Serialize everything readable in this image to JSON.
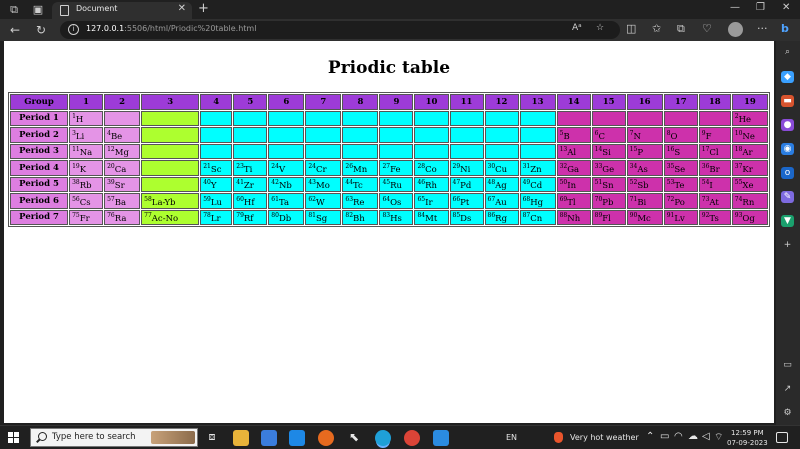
{
  "browser": {
    "tab_title": "Document",
    "url_host": "127.0.0.1",
    "url_rest": ":5506/html/Priodic%20table.html"
  },
  "page": {
    "title": "Priodic table"
  },
  "table": {
    "headers": [
      "Group",
      "1",
      "2",
      "3",
      "4",
      "5",
      "6",
      "7",
      "8",
      "9",
      "10",
      "11",
      "12",
      "13",
      "14",
      "15",
      "16",
      "17",
      "18",
      "19"
    ],
    "rows": [
      {
        "label": "Period 1",
        "cells": [
          [
            "pink",
            "1",
            "H"
          ],
          [
            "pink",
            "",
            ""
          ],
          [
            "lime",
            "",
            ""
          ],
          [
            "cyan",
            "",
            ""
          ],
          [
            "cyan",
            "",
            ""
          ],
          [
            "cyan",
            "",
            ""
          ],
          [
            "cyan",
            "",
            ""
          ],
          [
            "cyan",
            "",
            ""
          ],
          [
            "cyan",
            "",
            ""
          ],
          [
            "cyan",
            "",
            ""
          ],
          [
            "cyan",
            "",
            ""
          ],
          [
            "cyan",
            "",
            ""
          ],
          [
            "cyan",
            "",
            ""
          ],
          [
            "mag",
            "",
            ""
          ],
          [
            "mag",
            "",
            ""
          ],
          [
            "mag",
            "",
            ""
          ],
          [
            "mag",
            "",
            ""
          ],
          [
            "mag",
            "",
            ""
          ],
          [
            "mag",
            "2",
            "He"
          ]
        ]
      },
      {
        "label": "Period 2",
        "cells": [
          [
            "pink",
            "3",
            "Li"
          ],
          [
            "pink",
            "4",
            "Be"
          ],
          [
            "lime",
            "",
            ""
          ],
          [
            "cyan",
            "",
            ""
          ],
          [
            "cyan",
            "",
            ""
          ],
          [
            "cyan",
            "",
            ""
          ],
          [
            "cyan",
            "",
            ""
          ],
          [
            "cyan",
            "",
            ""
          ],
          [
            "cyan",
            "",
            ""
          ],
          [
            "cyan",
            "",
            ""
          ],
          [
            "cyan",
            "",
            ""
          ],
          [
            "cyan",
            "",
            ""
          ],
          [
            "cyan",
            "",
            ""
          ],
          [
            "mag",
            "5",
            "B"
          ],
          [
            "mag",
            "6",
            "C"
          ],
          [
            "mag",
            "7",
            "N"
          ],
          [
            "mag",
            "8",
            "O"
          ],
          [
            "mag",
            "9",
            "F"
          ],
          [
            "mag",
            "10",
            "Ne"
          ]
        ]
      },
      {
        "label": "Period 3",
        "cells": [
          [
            "pink",
            "11",
            "Na"
          ],
          [
            "pink",
            "12",
            "Mg"
          ],
          [
            "lime",
            "",
            ""
          ],
          [
            "cyan",
            "",
            ""
          ],
          [
            "cyan",
            "",
            ""
          ],
          [
            "cyan",
            "",
            ""
          ],
          [
            "cyan",
            "",
            ""
          ],
          [
            "cyan",
            "",
            ""
          ],
          [
            "cyan",
            "",
            ""
          ],
          [
            "cyan",
            "",
            ""
          ],
          [
            "cyan",
            "",
            ""
          ],
          [
            "cyan",
            "",
            ""
          ],
          [
            "cyan",
            "",
            ""
          ],
          [
            "mag",
            "13",
            "Al"
          ],
          [
            "mag",
            "14",
            "Si"
          ],
          [
            "mag",
            "15",
            "P"
          ],
          [
            "mag",
            "16",
            "S"
          ],
          [
            "mag",
            "17",
            "Cl"
          ],
          [
            "mag",
            "18",
            "Ar"
          ]
        ]
      },
      {
        "label": "Period 4",
        "cells": [
          [
            "pink",
            "19",
            "K"
          ],
          [
            "pink",
            "20",
            "Ca"
          ],
          [
            "lime",
            "",
            ""
          ],
          [
            "cyan",
            "21",
            "Sc"
          ],
          [
            "cyan",
            "23",
            "Ti"
          ],
          [
            "cyan",
            "24",
            "V"
          ],
          [
            "cyan",
            "24",
            "Cr"
          ],
          [
            "cyan",
            "26",
            "Mn"
          ],
          [
            "cyan",
            "27",
            "Fe"
          ],
          [
            "cyan",
            "28",
            "Co"
          ],
          [
            "cyan",
            "29",
            "Ni"
          ],
          [
            "cyan",
            "30",
            "Cu"
          ],
          [
            "cyan",
            "31",
            "Zn"
          ],
          [
            "mag",
            "32",
            "Ga"
          ],
          [
            "mag",
            "33",
            "Ge"
          ],
          [
            "mag",
            "34",
            "As"
          ],
          [
            "mag",
            "35",
            "Se"
          ],
          [
            "mag",
            "36",
            "Br"
          ],
          [
            "mag",
            "37",
            "Kr"
          ]
        ]
      },
      {
        "label": "Period 5",
        "cells": [
          [
            "pink",
            "38",
            "Rb"
          ],
          [
            "pink",
            "39",
            "Sr"
          ],
          [
            "lime",
            "",
            ""
          ],
          [
            "cyan",
            "40",
            "Y"
          ],
          [
            "cyan",
            "41",
            "Zr"
          ],
          [
            "cyan",
            "42",
            "Nb"
          ],
          [
            "cyan",
            "43",
            "Mo"
          ],
          [
            "cyan",
            "44",
            "Tc"
          ],
          [
            "cyan",
            "45",
            "Ru"
          ],
          [
            "cyan",
            "46",
            "Rh"
          ],
          [
            "cyan",
            "47",
            "Pd"
          ],
          [
            "cyan",
            "48",
            "Ag"
          ],
          [
            "cyan",
            "49",
            "Cd"
          ],
          [
            "mag",
            "50",
            "In"
          ],
          [
            "mag",
            "51",
            "Sn"
          ],
          [
            "mag",
            "52",
            "Sb"
          ],
          [
            "mag",
            "53",
            "Te"
          ],
          [
            "mag",
            "54",
            "I"
          ],
          [
            "mag",
            "55",
            "Xe"
          ]
        ]
      },
      {
        "label": "Period 6",
        "cells": [
          [
            "pink",
            "56",
            "Cs"
          ],
          [
            "pink",
            "57",
            "Ba"
          ],
          [
            "lime",
            "58",
            "La-Yb"
          ],
          [
            "cyan",
            "59",
            "Lu"
          ],
          [
            "cyan",
            "60",
            "Hf"
          ],
          [
            "cyan",
            "61",
            "Ta"
          ],
          [
            "cyan",
            "62",
            "W"
          ],
          [
            "cyan",
            "63",
            "Re"
          ],
          [
            "cyan",
            "64",
            "Os"
          ],
          [
            "cyan",
            "65",
            "Ir"
          ],
          [
            "cyan",
            "66",
            "Pt"
          ],
          [
            "cyan",
            "67",
            "Au"
          ],
          [
            "cyan",
            "68",
            "Hg"
          ],
          [
            "mag",
            "69",
            "Tl"
          ],
          [
            "mag",
            "70",
            "Pb"
          ],
          [
            "mag",
            "71",
            "Bi"
          ],
          [
            "mag",
            "72",
            "Po"
          ],
          [
            "mag",
            "73",
            "At"
          ],
          [
            "mag",
            "74",
            "Rn"
          ]
        ]
      },
      {
        "label": "Period 7",
        "cells": [
          [
            "pink",
            "75",
            "Fr"
          ],
          [
            "pink",
            "76",
            "Ra"
          ],
          [
            "lime",
            "77",
            "Ac-No"
          ],
          [
            "cyan",
            "78",
            "Lr"
          ],
          [
            "cyan",
            "79",
            "Rf"
          ],
          [
            "cyan",
            "80",
            "Db"
          ],
          [
            "cyan",
            "81",
            "Sg"
          ],
          [
            "cyan",
            "82",
            "Bh"
          ],
          [
            "cyan",
            "83",
            "Hs"
          ],
          [
            "cyan",
            "84",
            "Mt"
          ],
          [
            "cyan",
            "85",
            "Ds"
          ],
          [
            "cyan",
            "86",
            "Rg"
          ],
          [
            "cyan",
            "87",
            "Cn"
          ],
          [
            "mag",
            "88",
            "Nh"
          ],
          [
            "mag",
            "89",
            "Fl"
          ],
          [
            "mag",
            "90",
            "Mc"
          ],
          [
            "mag",
            "91",
            "Lv"
          ],
          [
            "mag",
            "92",
            "Ts"
          ],
          [
            "mag",
            "93",
            "Og"
          ]
        ]
      }
    ]
  },
  "taskbar": {
    "search_placeholder": "Type here to search",
    "language": "EN",
    "weather": "Very hot weather",
    "time": "12:59 PM",
    "date": "07-09-2023"
  },
  "colors": {
    "header": "#9d3bd8",
    "period": "#dd7ee0",
    "pink": "#e494e6",
    "lime": "#adff2f",
    "cyan": "#00ffff",
    "magenta": "#cd31ab"
  }
}
